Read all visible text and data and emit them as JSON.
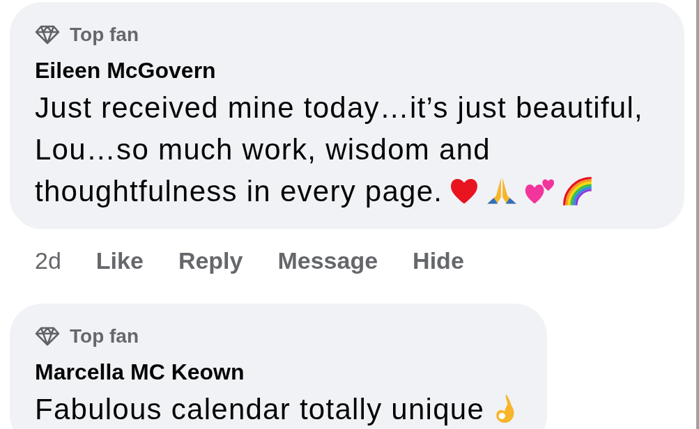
{
  "comments": [
    {
      "badge": "Top fan",
      "author": "Eileen McGovern",
      "text": "Just received mine today…it’s just beautiful, Lou…so much work, wisdom and thoughtfulness in every page.",
      "emojis": [
        {
          "kind": "heart"
        },
        {
          "kind": "pray"
        },
        {
          "kind": "hearts"
        },
        {
          "kind": "rainbow"
        }
      ],
      "time": "2d",
      "actions": [
        "Like",
        "Reply",
        "Message",
        "Hide"
      ]
    },
    {
      "badge": "Top fan",
      "author": "Marcella MC Keown",
      "text": "Fabulous calendar  totally unique",
      "emojis": [
        {
          "kind": "ok"
        }
      ]
    }
  ]
}
